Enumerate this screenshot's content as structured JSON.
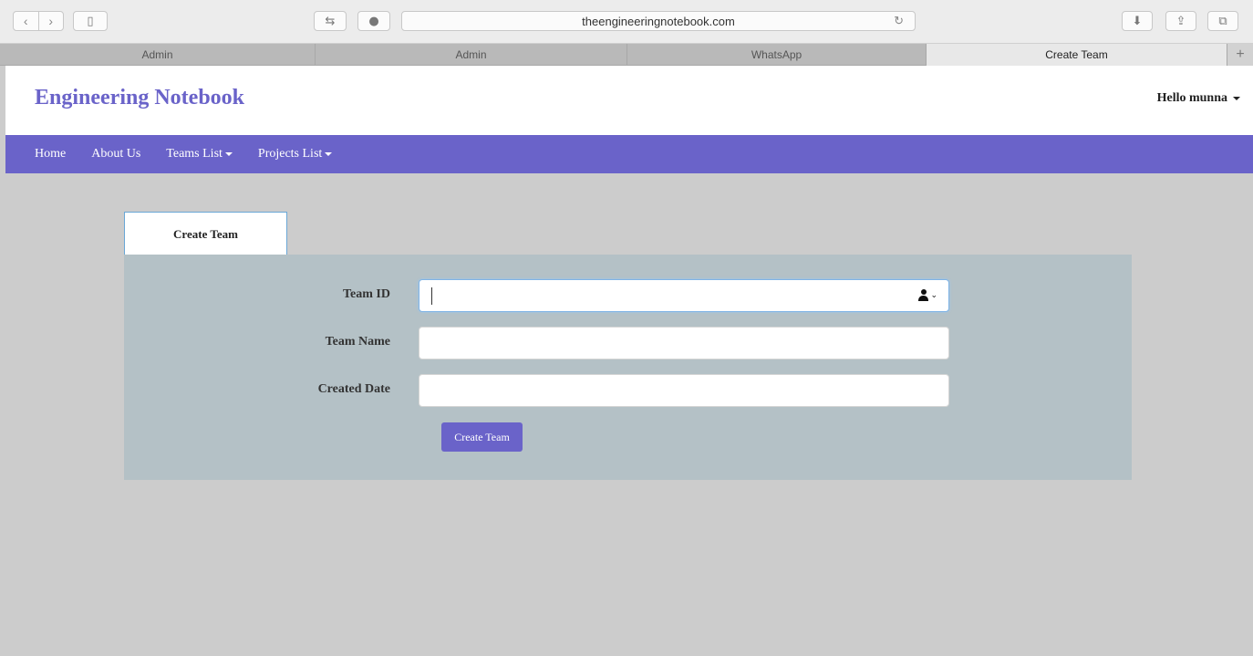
{
  "browser": {
    "url": "theengineeringnotebook.com",
    "tabs": [
      {
        "label": "Admin",
        "active": false
      },
      {
        "label": "Admin",
        "active": false
      },
      {
        "label": "WhatsApp",
        "active": false
      },
      {
        "label": "Create Team",
        "active": true
      }
    ],
    "new_tab": "+"
  },
  "header": {
    "brand": "Engineering Notebook",
    "user_greeting": "Hello munna"
  },
  "nav": {
    "items": [
      {
        "label": "Home"
      },
      {
        "label": "About Us"
      },
      {
        "label": "Teams List"
      },
      {
        "label": "Projects List"
      }
    ]
  },
  "form": {
    "tab_label": "Create Team",
    "fields": [
      {
        "label": "Team ID",
        "value": ""
      },
      {
        "label": "Team Name",
        "value": ""
      },
      {
        "label": "Created Date",
        "value": ""
      }
    ],
    "submit_label": "Create Team"
  },
  "colors": {
    "accent": "#6a63c9",
    "panel": "#b4c1c6",
    "page_bg": "#cccccc"
  }
}
